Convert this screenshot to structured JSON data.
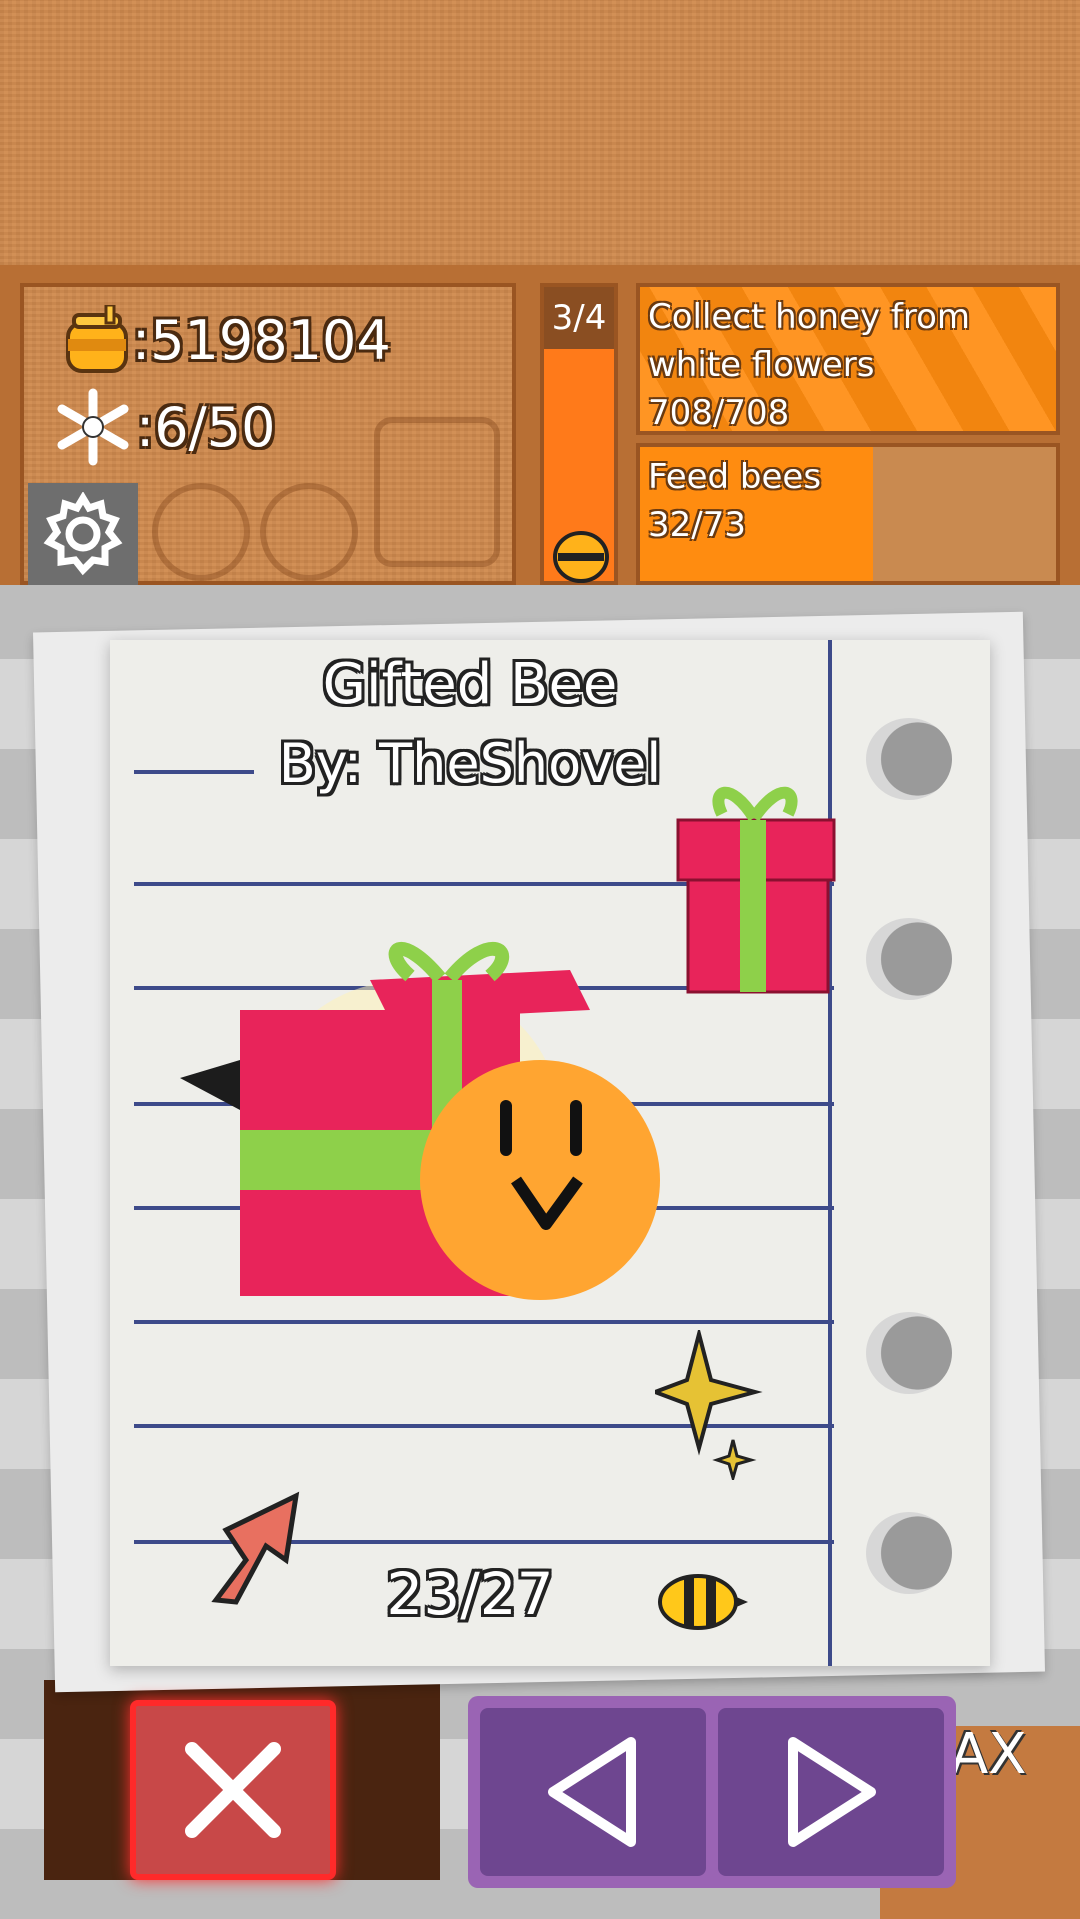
{
  "hud": {
    "honey_value": ":5198104",
    "ticket_value": ":6/50",
    "quest_count": "3/4",
    "quests": [
      {
        "title": "Collect honey from",
        "title2": "white flowers",
        "progress": "708/708"
      },
      {
        "title": "Feed bees",
        "progress": "32/73"
      }
    ]
  },
  "card": {
    "title": "Gifted Bee",
    "author": "By: TheShovel",
    "page": "23/27"
  },
  "icons": {
    "honey": "honey-jar-icon",
    "ticket": "snowflake-icon",
    "settings": "gear-icon",
    "egg": "egg-icon",
    "close": "close-icon",
    "prev": "triangle-left-icon",
    "next": "triangle-right-icon"
  },
  "colors": {
    "wood": "#d08a4e",
    "quest_orange": "#ff8c10",
    "close_red": "#c84848",
    "nav_purple": "#6e4690",
    "gift_pink": "#e8245a",
    "ribbon_green": "#8ed04a"
  },
  "buttons": {
    "max_label": "AX"
  }
}
